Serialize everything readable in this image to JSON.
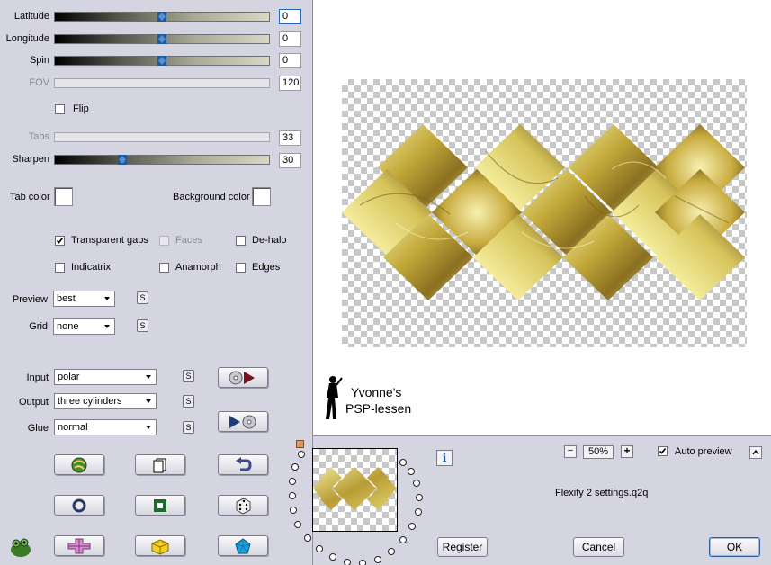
{
  "sliders": [
    {
      "label": "Latitude",
      "value": "0",
      "position": 0.5,
      "enabled": true
    },
    {
      "label": "Longitude",
      "value": "0",
      "position": 0.5,
      "enabled": true
    },
    {
      "label": "Spin",
      "value": "0",
      "position": 0.5,
      "enabled": true
    },
    {
      "label": "FOV",
      "value": "120",
      "enabled": false
    },
    {
      "label": "Tabs",
      "value": "33",
      "enabled": false
    },
    {
      "label": "Sharpen",
      "value": "30",
      "position": 0.3,
      "enabled": true
    }
  ],
  "flip": {
    "label": "Flip",
    "checked": false
  },
  "colors": {
    "tab_color_label": "Tab color",
    "background_color_label": "Background color"
  },
  "options": {
    "transparent_gaps": {
      "label": "Transparent gaps",
      "checked": true
    },
    "faces": {
      "label": "Faces",
      "checked": false,
      "enabled": false
    },
    "dehalo": {
      "label": "De-halo",
      "checked": false
    },
    "indicatrix": {
      "label": "Indicatrix",
      "checked": false
    },
    "anamorph": {
      "label": "Anamorph",
      "checked": false
    },
    "edges": {
      "label": "Edges",
      "checked": false
    }
  },
  "preview_select": {
    "label": "Preview",
    "value": "best"
  },
  "grid_select": {
    "label": "Grid",
    "value": "none"
  },
  "input_select": {
    "label": "Input",
    "value": "polar"
  },
  "output_select": {
    "label": "Output",
    "value": "three cylinders"
  },
  "glue_select": {
    "label": "Glue",
    "value": "normal"
  },
  "s_button_label": "S",
  "zoom": {
    "minus": "−",
    "value": "50%",
    "plus": "+"
  },
  "auto_preview": {
    "label": "Auto preview",
    "checked": true
  },
  "info_label": "i",
  "settings_file": "Flexify 2 settings.q2q",
  "buttons": {
    "register": "Register",
    "cancel": "Cancel",
    "ok": "OK"
  },
  "watermark": {
    "line1": "Yvonne's",
    "line2": "PSP-lessen"
  },
  "accent": "#1d5a9c"
}
